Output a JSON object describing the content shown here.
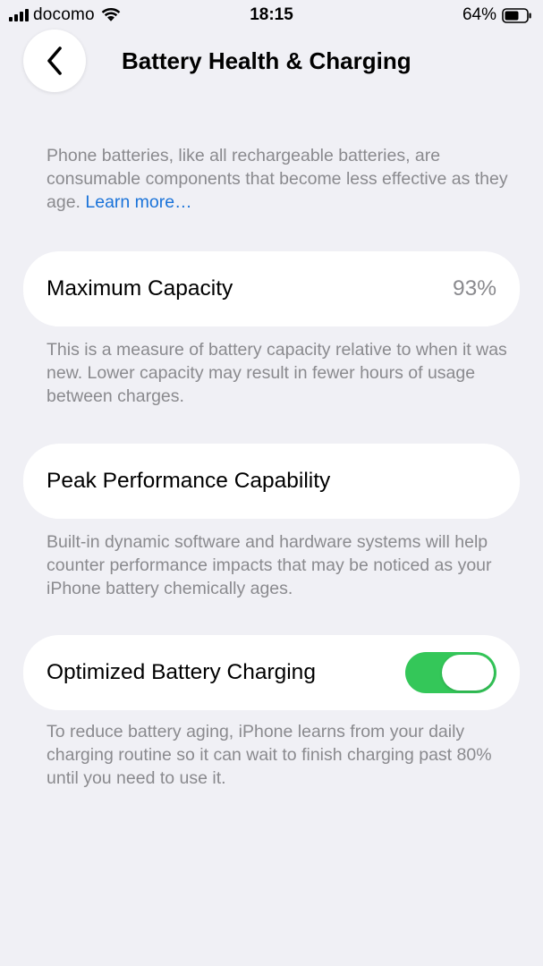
{
  "status_bar": {
    "carrier": "docomo",
    "time": "18:15",
    "battery_percent": "64%",
    "icons": [
      "cellular-signal-icon",
      "wifi-icon",
      "battery-icon"
    ]
  },
  "nav": {
    "back_icon": "chevron-left-icon",
    "title": "Battery Health & Charging"
  },
  "intro": {
    "text": "Phone batteries, like all rechargeable batteries, are consumable components that become less effective as they age.",
    "link": "Learn more…"
  },
  "maximum_capacity": {
    "label": "Maximum Capacity",
    "value": "93%",
    "description": "This is a measure of battery capacity relative to when it was new. Lower capacity may result in fewer hours of usage between charges."
  },
  "peak_performance": {
    "label": "Peak Performance Capability",
    "description": "Built-in dynamic software and hardware systems will help counter performance impacts that may be noticed as your iPhone battery chemically ages."
  },
  "optimized_charging": {
    "label": "Optimized Battery Charging",
    "enabled": true,
    "description": "To reduce battery aging, iPhone learns from your daily charging routine so it can wait to finish charging past 80% until you need to use it."
  },
  "colors": {
    "background": "#f0f0f5",
    "card": "#ffffff",
    "secondary_text": "#8a8a8e",
    "link": "#1a73d9",
    "toggle_on": "#34c759"
  }
}
